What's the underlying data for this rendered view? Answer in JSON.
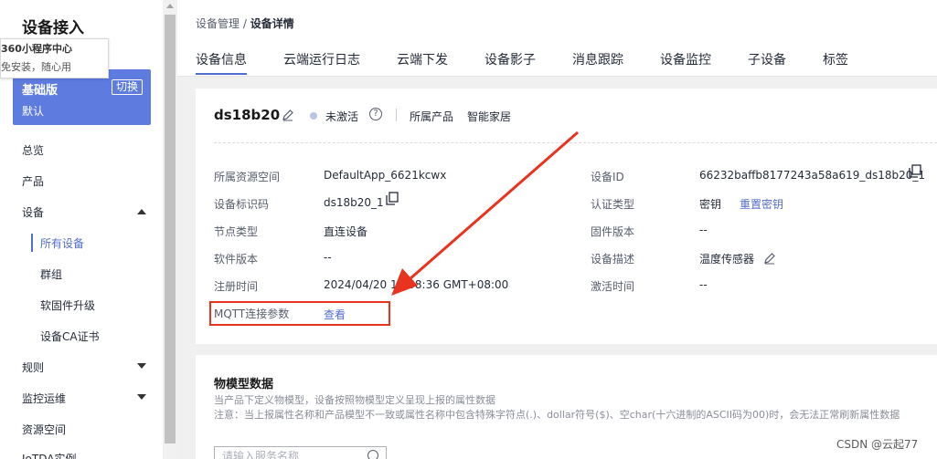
{
  "sidebar": {
    "title": "设备接入",
    "popup": {
      "line1": "360小程序中心",
      "line2": "免安装，随心用"
    },
    "edition": {
      "name": "基础版",
      "switch": "切换",
      "default": "默认"
    },
    "nav": {
      "overview": "总览",
      "product": "产品",
      "device": "设备",
      "all_devices": "所有设备",
      "groups": "群组",
      "firmware": "软固件升级",
      "ca_cert": "设备CA证书",
      "rules": "规则",
      "monitoring": "监控运维",
      "resource_space": "资源空间",
      "iotda_instance": "IoTDA实例"
    }
  },
  "header": {
    "breadcrumb_root": "设备管理",
    "breadcrumb_sep": " / ",
    "breadcrumb_current": "设备详情",
    "tabs": [
      "设备信息",
      "云端运行日志",
      "云端下发",
      "设备影子",
      "消息跟踪",
      "设备监控",
      "子设备",
      "标签"
    ]
  },
  "device": {
    "name": "ds18b20",
    "status": "未激活",
    "product_label": "所属产品",
    "product_value": "智能家居",
    "fields": {
      "resource_space_label": "所属资源空间",
      "resource_space_value": "DefaultApp_6621kcwx",
      "identifier_label": "设备标识码",
      "identifier_value": "ds18b20_1",
      "node_type_label": "节点类型",
      "node_type_value": "直连设备",
      "software_label": "软件版本",
      "software_value": "--",
      "register_label": "注册时间",
      "register_value": "2024/04/20 10:58:36 GMT+08:00",
      "mqtt_label": "MQTT连接参数",
      "mqtt_link": "查看",
      "device_id_label": "设备ID",
      "device_id_value": "66232baffb8177243a58a619_ds18b20_1",
      "auth_label": "认证类型",
      "auth_value": "密钥",
      "reset_key": "重置密钥",
      "firmware_label": "固件版本",
      "firmware_value": "--",
      "desc_label": "设备描述",
      "desc_value": "温度传感器",
      "activate_label": "激活时间",
      "activate_value": "--"
    }
  },
  "model": {
    "title": "物模型数据",
    "desc1": "当产品下定义物模型，设备按照物模型定义呈现上报的属性数据",
    "desc2": "注意：当上报属性名称和产品模型不一致或属性名称中包含特殊字符点(.)、dollar符号($)、空char(十六进制的ASCII码为00)时，会无法正常刷新属性数据",
    "search_placeholder": "请输入服务名称"
  },
  "watermark": "CSDN @云起77",
  "colors": {
    "accent": "#526ecc",
    "edition_bg": "#5e7ce0",
    "highlight": "#e8341f"
  }
}
